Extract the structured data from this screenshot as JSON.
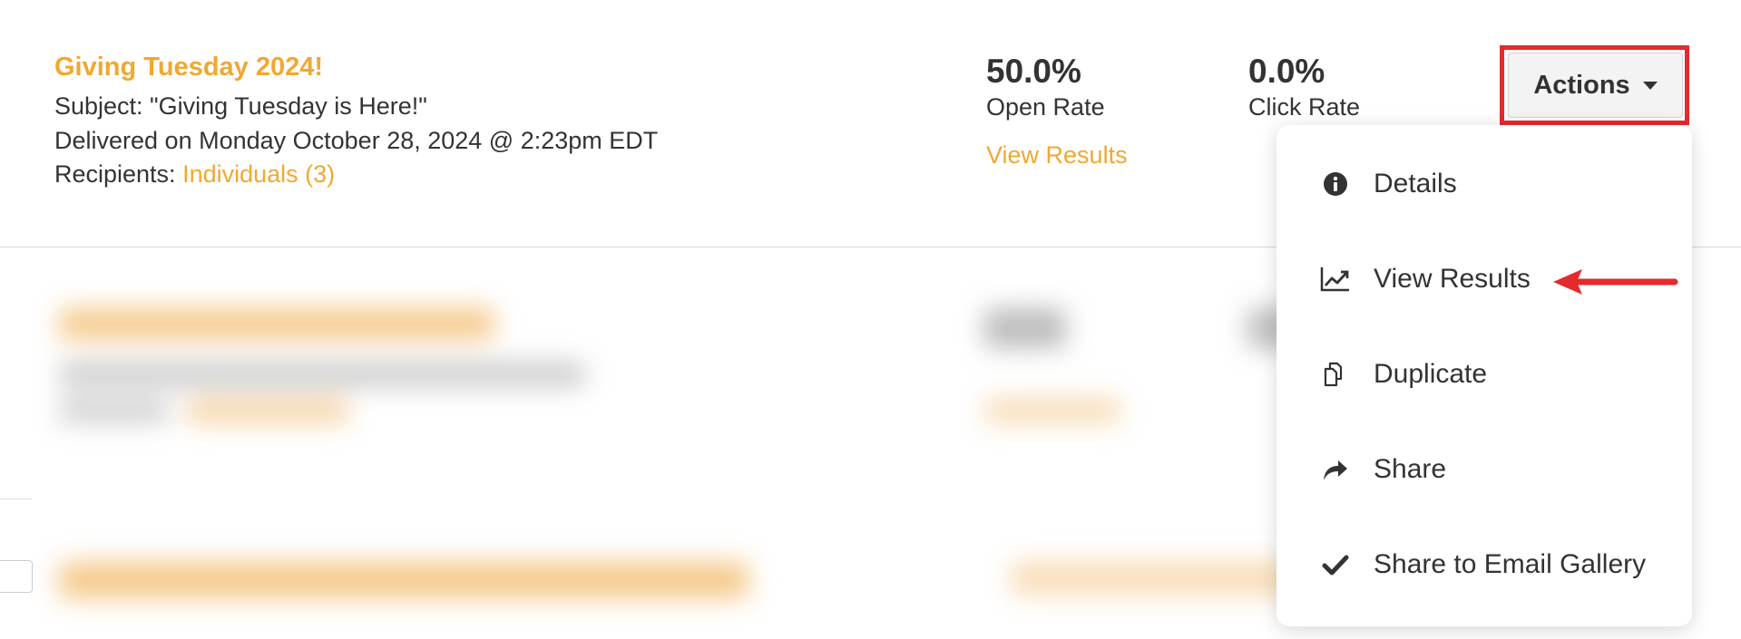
{
  "campaign": {
    "title": "Giving Tuesday 2024!",
    "subject": "Subject: \"Giving Tuesday is Here!\"",
    "delivered": "Delivered on Monday October 28, 2024 @ 2:23pm EDT",
    "recipients_label": "Recipients:",
    "recipients_link": "Individuals (3)",
    "open_rate": {
      "value": "50.0%",
      "label": "Open Rate"
    },
    "click_rate": {
      "value": "0.0%",
      "label": "Click Rate"
    },
    "view_results_link": "View Results"
  },
  "actions": {
    "button_label": "Actions",
    "menu": [
      {
        "label": "Details",
        "icon": "info-icon"
      },
      {
        "label": "View Results",
        "icon": "chart-line-icon"
      },
      {
        "label": "Duplicate",
        "icon": "copy-icon"
      },
      {
        "label": "Share",
        "icon": "share-icon"
      },
      {
        "label": "Share to Email Gallery",
        "icon": "check-icon"
      }
    ]
  },
  "colors": {
    "accent": "#f0a832",
    "text": "#333333",
    "highlight": "#e32b2b"
  }
}
